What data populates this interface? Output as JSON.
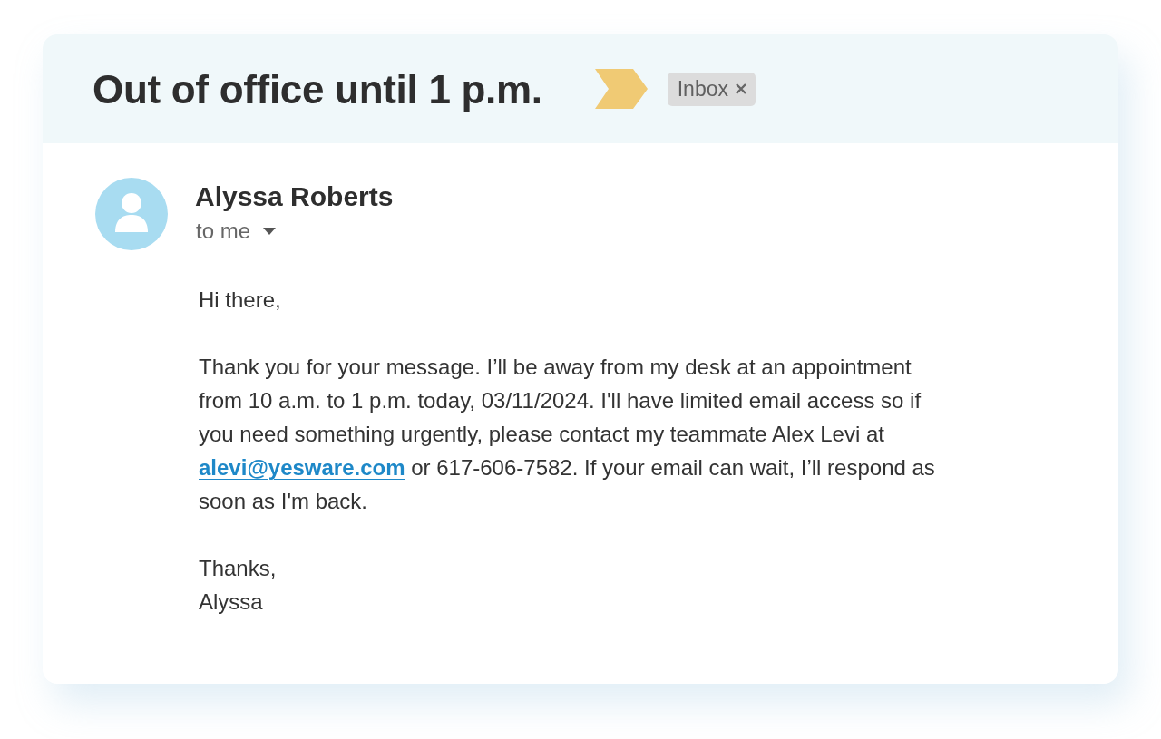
{
  "header": {
    "subject": "Out of office until 1 p.m.",
    "important": true,
    "labels": [
      {
        "text": "Inbox",
        "removable": true
      }
    ]
  },
  "sender": {
    "name": "Alyssa Roberts",
    "recipient": "to me"
  },
  "body": {
    "greeting": "Hi there,",
    "paragraph": [
      {
        "kind": "text",
        "text": "Thank you for your message. I’ll be away from my desk at an appointment from 10 a.m. to 1 p.m. today, 03/11/2024. I'll have limited email access so if you need something urgently, please contact my teammate Alex Levi at "
      },
      {
        "kind": "link",
        "text": "alevi@yesware.com"
      },
      {
        "kind": "text",
        "text": " or 617-606-7582. If your email can wait, I’ll respond as soon as I'm back."
      }
    ],
    "closing": [
      "Thanks,",
      "Alyssa"
    ]
  }
}
